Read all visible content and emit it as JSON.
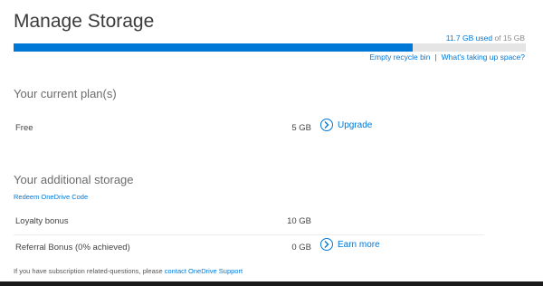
{
  "header": {
    "title": "Manage Storage"
  },
  "usage": {
    "used": "11.7 GB used",
    "of_label": " of ",
    "total": "15 GB",
    "fraction": 0.78
  },
  "links": {
    "empty_recycle_bin": "Empty recycle bin",
    "separator": "|",
    "whats_taking_up_space": "What's taking up space?"
  },
  "plans": {
    "section_title": "Your current plan(s)",
    "items": [
      {
        "name": "Free",
        "size": "5 GB",
        "action": "Upgrade"
      }
    ]
  },
  "additional": {
    "section_title": "Your additional storage",
    "redeem_link": "Redeem OneDrive Code",
    "items": [
      {
        "name": "Loyalty bonus",
        "size": "10 GB"
      },
      {
        "name": "Referral Bonus (0% achieved)",
        "size": "0 GB",
        "action": "Earn more"
      }
    ]
  },
  "footer": {
    "text": "If you have subscription related-questions, please ",
    "link": "contact OneDrive Support"
  },
  "colors": {
    "accent": "#0078d7",
    "track": "#e5e5e5"
  },
  "icons": {
    "action": "chevron-right-circle-icon"
  }
}
